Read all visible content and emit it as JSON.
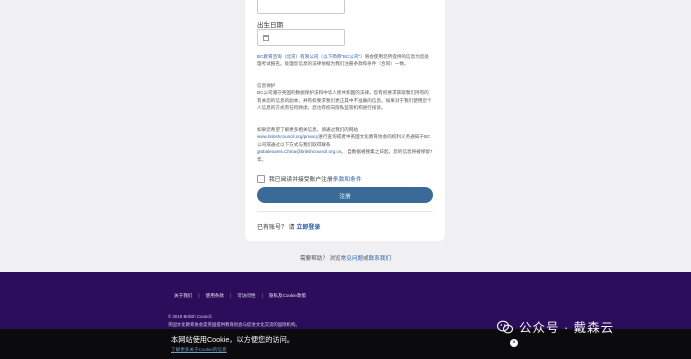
{
  "form": {
    "dob_label": "出生日期",
    "privacy_text_1_pre": "BC教育咨询（北京）有限公司（以下简称“BC公司”）",
    "privacy_text_1_post": "将会使用您所提供的信息为您处理考试报名。处理您信息的法律依据为我们注册条款和条件（合同）一致。",
    "privacy_head": "信息保护",
    "privacy_text_2": "BC公司遵守英国的数据保护法和中华人民共和国的法律。您有权要求获取我们持有的有关您的信息的副本，并有权要求我们更正其中不准确的信息。如果对于我们使用您个人信息的方式有任何顾虑，您也有权向隐私监管机构进行投诉。",
    "privacy_text_3_pre": "如果您希望了解更多相关信息，请通过我们的网站",
    "privacy_url": "www.britishcouncil.org/privacy",
    "privacy_text_3_mid": "进行查询或者中英国文化教育协会的权利义务通知于BC公司或通过以下方式与我们取得联系",
    "privacy_email": "globalexams.China@britishcouncil.org.cn",
    "privacy_text_3_post": "。 自数据被搜集之日起，您的信息将被保留7年。",
    "agree_pre": "我已阅读并接受账户注册",
    "agree_link": "条款和条件",
    "register_button": "注册",
    "account_q": "已有账号？ 请",
    "login_link": "立即登录"
  },
  "help": {
    "pre": "需要帮助？ 浏览",
    "link1": "常见问题",
    "mid": "或",
    "link2": "联系我们"
  },
  "footer": {
    "links": [
      "关于我们",
      "使用条款",
      "可访问性",
      "隐私及Cookie政策"
    ],
    "copyright": "© 2019 British Council",
    "fine": "英国文化教育协会是英国提供教育机会与促进文化交流的国际机构。"
  },
  "cookie": {
    "message": "本网站使用Cookie，以方便您的访问。",
    "link": "了解更多关于Cookie的信息",
    "close": "×"
  },
  "watermark": {
    "text": "公众号 · 戴森云"
  }
}
